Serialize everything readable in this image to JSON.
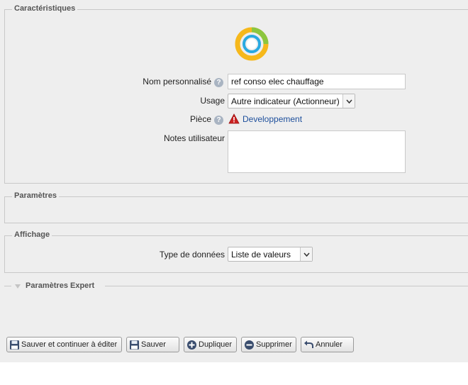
{
  "characteristics": {
    "legend": "Caractéristiques",
    "name_label": "Nom personnalisé",
    "name_value": "ref conso elec chauffage",
    "usage_label": "Usage",
    "usage_value": "Autre indicateur (Actionneur)",
    "room_label": "Pièce",
    "room_link": "Developpement",
    "notes_label": "Notes utilisateur",
    "notes_value": ""
  },
  "parameters": {
    "legend": "Paramètres"
  },
  "display": {
    "legend": "Affichage",
    "data_type_label": "Type de données",
    "data_type_value": "Liste de valeurs"
  },
  "expert": {
    "legend": "Paramètres Expert"
  },
  "actions": {
    "save_continue": "Sauver et continuer à éditer",
    "save": "Sauver",
    "duplicate": "Dupliquer",
    "delete": "Supprimer",
    "cancel": "Annuler"
  },
  "colors": {
    "panel_bg": "#eeeeee",
    "link": "#1d4f9c",
    "ring_green": "#8cc63f",
    "ring_yellow": "#f6b81b",
    "ring_blue": "#29a9e1",
    "warning_red": "#cc2222"
  },
  "icons": [
    "indicator-ring-icon",
    "help-icon",
    "warning-icon",
    "floppy-disk-icon",
    "plus-circle-icon",
    "minus-circle-icon",
    "undo-arrow-icon",
    "chevron-down-icon",
    "triangle-down-icon"
  ]
}
